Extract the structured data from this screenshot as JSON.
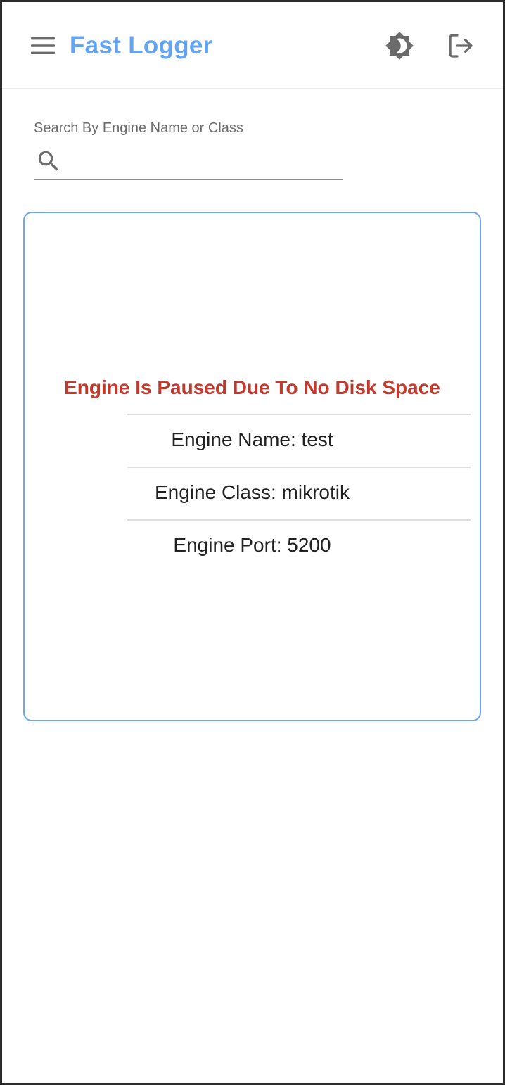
{
  "app": {
    "title": "Fast Logger"
  },
  "header": {
    "menu_icon": "hamburger-menu-icon",
    "theme_icon": "brightness-contrast-icon",
    "logout_icon": "logout-icon"
  },
  "search": {
    "label": "Search By Engine Name or Class",
    "value": "",
    "icon": "search-icon"
  },
  "engines": [
    {
      "status": "Engine Is Paused Due To No Disk Space",
      "name_line": "Engine Name: test",
      "class_line": "Engine Class: mikrotik",
      "port_line": "Engine Port: 5200"
    }
  ],
  "colors": {
    "brand": "#63a4f2",
    "status_error": "#c2392d",
    "card_border": "#6fa7ec",
    "icon_gray": "#6b6b6b"
  }
}
